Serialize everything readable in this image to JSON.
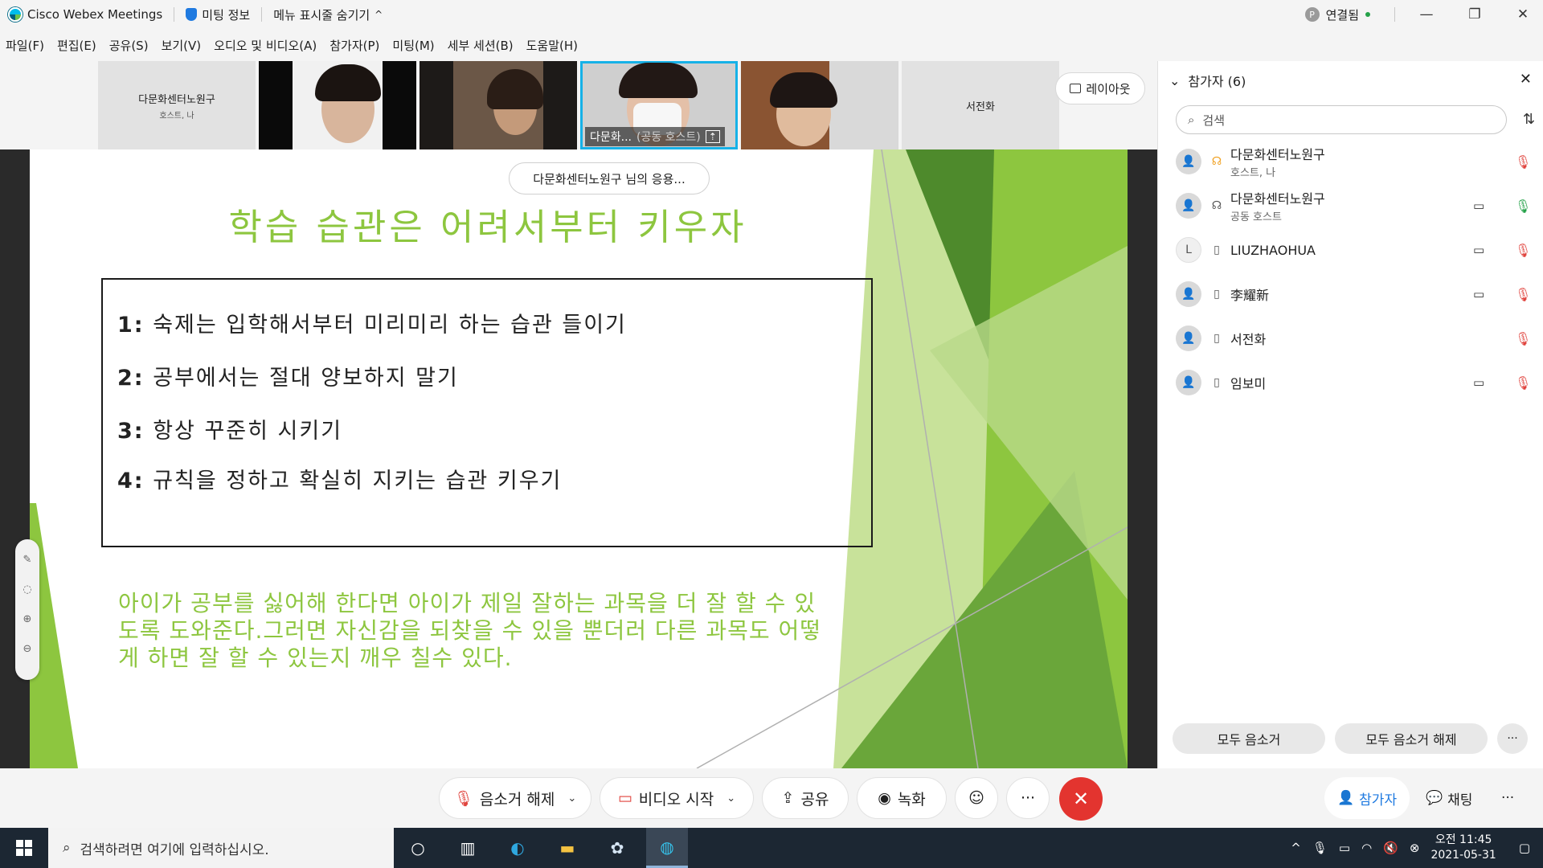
{
  "titlebar": {
    "app_name": "Cisco Webex Meetings",
    "meeting_info": "미팅 정보",
    "hide_menu": "메뉴 표시줄 숨기기",
    "hide_menu_chevron": "^",
    "connection_avatar": "P",
    "connection_status": "연결됨",
    "minimize": "—",
    "restore": "❐",
    "close": "✕"
  },
  "menu": [
    "파일(F)",
    "편집(E)",
    "공유(S)",
    "보기(V)",
    "오디오 및 비디오(A)",
    "참가자(P)",
    "미팅(M)",
    "세부 세션(B)",
    "도움말(H)"
  ],
  "filmstrip": {
    "tile1_name": "다문화센터노원구",
    "tile1_sub": "호스트, 나",
    "tile4_name": "다문화...",
    "tile4_role": "(공동 호스트)",
    "tile6_name": "서전화",
    "layout_label": "레이아웃"
  },
  "share": {
    "pill_text": "다문화센터노원구 님의 응용..."
  },
  "slide": {
    "title": "학습 습관은  어려서부터 키우자",
    "items": [
      {
        "num": "1:",
        "text": "숙제는 입학해서부터  미리미리 하는 습관 들이기"
      },
      {
        "num": "2:",
        "text": "공부에서는  절대 양보하지 말기"
      },
      {
        "num": "3:",
        "text": "항상 꾸준히 시키기"
      },
      {
        "num": "4:",
        "text": "규칙을  정하고  확실히 지키는 습관  키우기"
      }
    ],
    "para_lines": [
      "아이가  공부를 싫어해 한다면 아이가 제일  잘하는 과목을  더 잘 할 수 있",
      "도록  도와준다.그러면 자신감을 되찾을 수 있을 뿐더러 다른 과목도 어떻",
      "게 하면  잘 할 수 있는지 깨우 칠수 있다."
    ],
    "colors": {
      "green": "#8dc63f",
      "dark_green": "#4e8a2c",
      "light_green": "#c8e29a"
    }
  },
  "participants": {
    "header": "참가자 (6)",
    "search_placeholder": "검색",
    "list": [
      {
        "name": "다문화센터노원구",
        "role": "호스트, 나",
        "avatar": "",
        "status_icon": "headset-orange-icon",
        "video": false,
        "mic": "muted"
      },
      {
        "name": "다문화센터노원구",
        "role": "공동 호스트",
        "avatar": "",
        "status_icon": "headset-icon",
        "video": true,
        "mic": "live"
      },
      {
        "name": "LIUZHAOHUA",
        "role": "",
        "avatar": "L",
        "status_icon": "phone-icon",
        "video": true,
        "mic": "muted"
      },
      {
        "name": "李耀新",
        "role": "",
        "avatar": "",
        "status_icon": "phone-icon",
        "video": true,
        "mic": "muted"
      },
      {
        "name": "서전화",
        "role": "",
        "avatar": "",
        "status_icon": "phone-icon",
        "video": false,
        "mic": "muted"
      },
      {
        "name": "임보미",
        "role": "",
        "avatar": "",
        "status_icon": "phone-icon",
        "video": true,
        "mic": "muted"
      }
    ],
    "mute_all": "모두 음소거",
    "unmute_all": "모두 음소거 해제",
    "more": "···"
  },
  "controls": {
    "unmute": "음소거 해제",
    "start_video": "비디오 시작",
    "share": "공유",
    "record": "녹화",
    "more": "···",
    "end": "✕",
    "participants": "참가자",
    "chat": "채팅",
    "right_more": "···"
  },
  "taskbar": {
    "search_placeholder": "검색하려면 여기에 입력하십시오.",
    "time": "오전 11:45",
    "date": "2021-05-31"
  }
}
